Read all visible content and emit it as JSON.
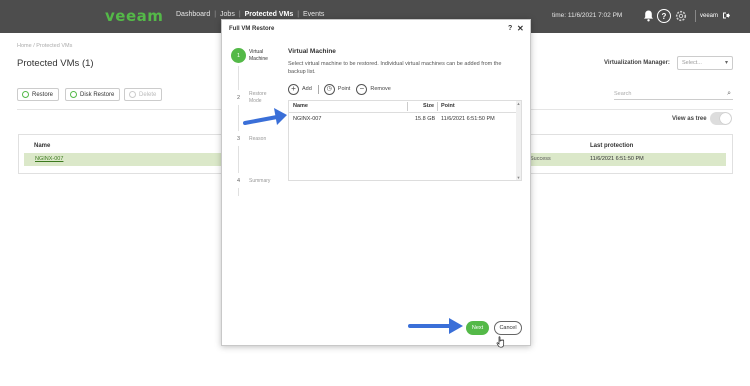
{
  "app": {
    "logo": "veeam"
  },
  "nav": {
    "dashboard": "Dashboard",
    "jobs": "Jobs",
    "protected_vms": "Protected VMs",
    "events": "Events",
    "sep": "|"
  },
  "header": {
    "time": "time: 11/6/2021 7:02 PM",
    "help": "?",
    "user": "veeam"
  },
  "page": {
    "breadcrumb": "Home / Protected VMs",
    "title": "Protected VMs (1)",
    "virtualization_label": "Virtualization Manager:",
    "virtualization_placeholder": "Select...",
    "search_placeholder": "Search",
    "view_as_tree": "View as tree",
    "toolbar": {
      "restore": "Restore",
      "disk_restore": "Disk Restore",
      "delete": "Delete"
    },
    "grid": {
      "headers": {
        "name": "Name",
        "last_protection": "Last protection"
      },
      "row": {
        "name": "NGINX-007",
        "mid": "Success",
        "last_protection": "11/6/2021 6:51:50 PM"
      }
    }
  },
  "modal": {
    "title": "Full VM Restore",
    "help": "?",
    "close": "✕",
    "steps": [
      {
        "num": "1",
        "label": "Virtual Machine"
      },
      {
        "num": "2",
        "label": "Restore Mode"
      },
      {
        "num": "3",
        "label": "Reason"
      },
      {
        "num": "4",
        "label": "Summary"
      }
    ],
    "heading": "Virtual Machine",
    "description": "Select virtual machine to be restored. Individual virtual machines can be added from the backup list.",
    "tools": {
      "add": "Add",
      "point": "Point",
      "remove": "Remove"
    },
    "table": {
      "headers": {
        "name": "Name",
        "size": "Size",
        "point": "Point"
      },
      "row": {
        "name": "NGINX-007",
        "size": "15.8 GB",
        "point": "11/6/2021 6:51:50 PM"
      }
    },
    "buttons": {
      "next": "Next",
      "cancel": "Cancel"
    }
  },
  "colors": {
    "brand_green": "#54b948",
    "topbar": "#4d4d4d",
    "arrow_blue": "#3a6fd8",
    "row_highlight": "#dbe8c9"
  }
}
